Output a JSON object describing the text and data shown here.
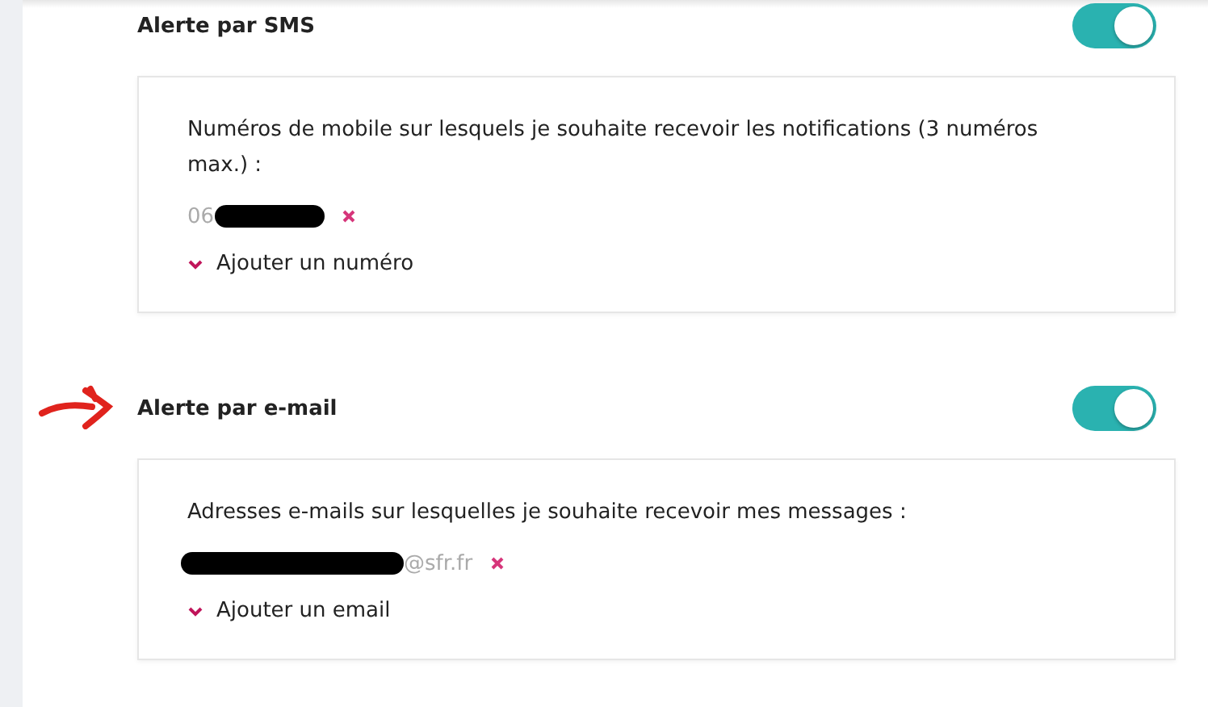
{
  "sections": [
    {
      "title": "Alerte par SMS",
      "on": true,
      "annotated": false,
      "intro": "Numéros de mobile sur lesquels je souhaite recevoir les notifications (3 numéros max.) :",
      "entries": [
        {
          "before": "06"
        }
      ],
      "add_label": "Ajouter un numéro"
    },
    {
      "title": "Alerte par e-mail",
      "on": true,
      "annotated": true,
      "intro": "Adresses e-mails sur lesquelles je souhaite recevoir mes messages :",
      "entries": [
        {
          "after": "@sfr.fr"
        }
      ],
      "add_label": "Ajouter un email"
    }
  ]
}
